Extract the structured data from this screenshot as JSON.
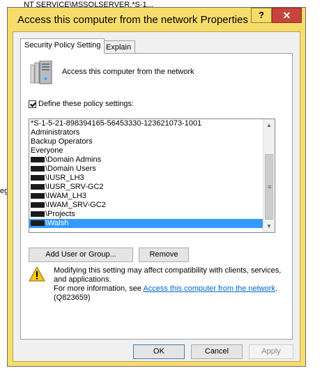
{
  "background": {
    "top_text": "NT SERVICE\\MSSQLSERVER,*S-1...",
    "left_text": "eg"
  },
  "window": {
    "title": "Access this computer from the network Properties",
    "help_label": "?",
    "close_label": "✕"
  },
  "tabs": [
    {
      "label": "Security Policy Setting"
    },
    {
      "label": "Explain"
    }
  ],
  "policy": {
    "icon": "server-policy-icon",
    "name": "Access this computer from the network",
    "define_label": "Define these policy settings:",
    "define_checked": true
  },
  "accounts": {
    "items": [
      "*S-1-5-21-898394165-56453330-123621073-1001",
      "Administrators",
      "Backup Operators",
      "Everyone",
      "\\Domain Admins",
      "\\Domain Users",
      "\\IUSR_LH3",
      "\\IUSR_SRV-GC2",
      "\\IWAM_LH3",
      "\\IWAM_SRV-GC2",
      "\\Projects",
      "\\Walsh"
    ],
    "selected_index": 11
  },
  "buttons": {
    "add": "Add User or Group...",
    "remove": "Remove",
    "ok": "OK",
    "cancel": "Cancel",
    "apply": "Apply"
  },
  "warning": {
    "icon": "warning-icon",
    "line1": "Modifying this setting may affect compatibility with clients, services, and applications.",
    "line2_prefix": "For more information, see ",
    "link": "Access this computer from the network",
    "line2_suffix": ".",
    "kb": "(Q823659)"
  },
  "colors": {
    "title_bar": "#f6dd6b",
    "close_button": "#c7443d",
    "selection": "#3399ff",
    "link": "#0066cc"
  }
}
